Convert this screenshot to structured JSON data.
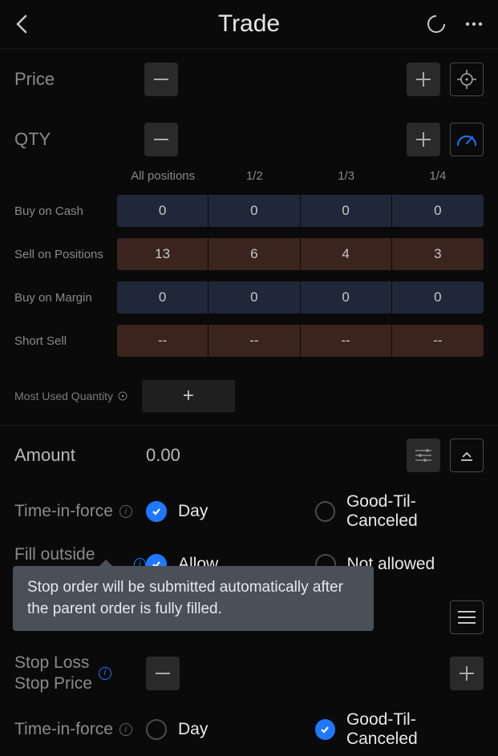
{
  "topbar": {
    "title": "Trade"
  },
  "price": {
    "label": "Price",
    "minus": "−",
    "plus": "+"
  },
  "qty": {
    "label": "QTY",
    "minus": "−",
    "plus": "+"
  },
  "qty_table": {
    "headers": [
      "All positions",
      "1/2",
      "1/3",
      "1/4"
    ],
    "rows": [
      {
        "label": "Buy on Cash",
        "type": "buy",
        "values": [
          "0",
          "0",
          "0",
          "0"
        ]
      },
      {
        "label": "Sell on Positions",
        "type": "sell",
        "values": [
          "13",
          "6",
          "4",
          "3"
        ]
      },
      {
        "label": "Buy on Margin",
        "type": "buy",
        "values": [
          "0",
          "0",
          "0",
          "0"
        ]
      },
      {
        "label": "Short Sell",
        "type": "sell",
        "values": [
          "--",
          "--",
          "--",
          "--"
        ]
      }
    ]
  },
  "muq": {
    "label": "Most Used Quantity",
    "plus": "+"
  },
  "amount": {
    "label": "Amount",
    "value": "0.00"
  },
  "tif1": {
    "label": "Time-in-force",
    "opt1": "Day",
    "opt2": "Good-Til-Canceled",
    "selected": 0
  },
  "fill": {
    "label": "Fill outside RTH",
    "opt1": "Allow",
    "opt2": "Not allowed",
    "selected": 0
  },
  "tooltip": "Stop order will be submitted automatically after the parent order is fully filled.",
  "stoploss": {
    "label1": "Stop Loss",
    "label2": "Stop Price",
    "minus": "−",
    "plus": "+"
  },
  "tif2": {
    "label": "Time-in-force",
    "opt1": "Day",
    "opt2": "Good-Til-Canceled",
    "selected": 1
  },
  "colors": {
    "accent": "#1f78ff",
    "buy_bg": "#1e2838",
    "sell_bg": "#3a241d"
  }
}
